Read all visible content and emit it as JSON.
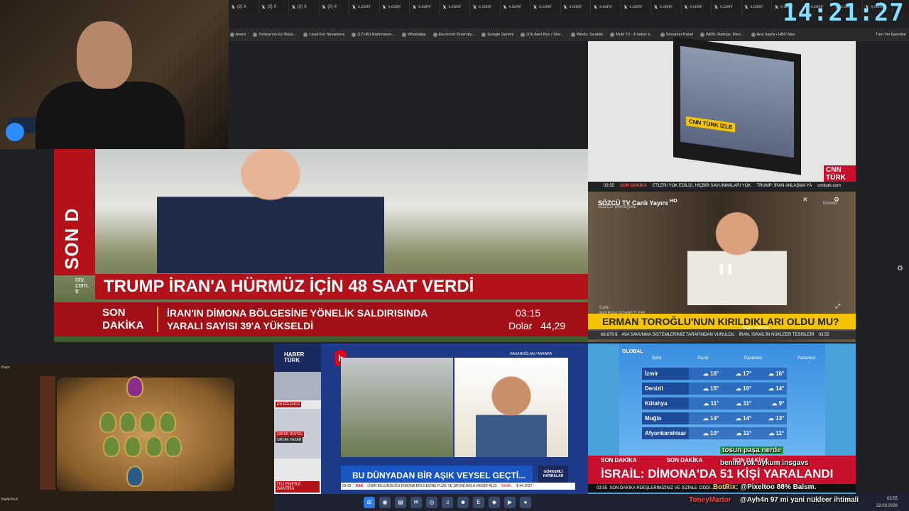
{
  "clock": "14:21:27",
  "browser": {
    "tabs": [
      {
        "label": "(2) X"
      },
      {
        "label": "(2) X"
      },
      {
        "label": "(2) X"
      },
      {
        "label": "(2) X"
      },
      {
        "label": "x.com/"
      },
      {
        "label": "x.com/"
      },
      {
        "label": "x.com/"
      },
      {
        "label": "x.com/"
      },
      {
        "label": "x.com/"
      },
      {
        "label": "x.com/"
      },
      {
        "label": "x.com/"
      },
      {
        "label": "x.com/"
      },
      {
        "label": "x.com/"
      },
      {
        "label": "x.com/"
      },
      {
        "label": "x.com/"
      },
      {
        "label": "x.com/"
      },
      {
        "label": "x.com/"
      },
      {
        "label": "x.com/"
      },
      {
        "label": "x.com/"
      },
      {
        "label": "x.com/"
      },
      {
        "label": "x.com/"
      },
      {
        "label": "x.com/"
      }
    ],
    "bookmarks": [
      "board",
      "Türkiye'nin En Büyü...",
      "Livad For Streamers",
      "(17145) Rammstein...",
      "WhatsApp",
      "Electronic Diversity...",
      "Google Gemini",
      "(19) Alert Box / Stre...",
      "Windy: Sıcaklık",
      "Multi TV - 6 haber k...",
      "Streamer Panel",
      "IMDb: Ratings, Revi...",
      "Ana Sayfa • HBO Max"
    ],
    "all_bookmarks": "Tüm Yer İşaretleri"
  },
  "ntv": {
    "side_label": "SON D",
    "logo": [
      "ntv.",
      "com.",
      "tr"
    ],
    "headline": "TRUMP İRAN'A HÜRMÜZ İÇİN 48 SAAT VERDİ",
    "ticker_label": [
      "SON",
      "DAKİKA"
    ],
    "ticker_text": [
      "İRAN'IN DİMONA BÖLGESİNE YÖNELİK SALDIRISINDA",
      "YARALI SAYISI 39'A YÜKSELDİ"
    ],
    "time": "03:15",
    "dolar_label": "Dolar",
    "dolar_value": "44,29"
  },
  "cnn": {
    "screen_text": "CNN TÜRK İZLE",
    "logo": "CNN TÜRK",
    "bar_time": "03:55",
    "bar_label": "SON DAKİKA",
    "bar_text": "ETLERİ YOK EDİLDİ, HİÇBİR SAVUNMALARI YOK",
    "bar_text2": "TRUMP: İRAN ANLAŞMA YA",
    "site": "cnnturk.com"
  },
  "sozcu": {
    "title": "SÖZCÜ TV Canlı Yayını",
    "hd": "HD",
    "subtitle": "SÖZCÜ Televizyonu",
    "canli": "Canlı",
    "program": "BAYRAM SOHBETLERİ",
    "headline": "ERMAN TOROĞLU'NUN KIRILDIKLARI OLDU MU?",
    "diger": "Diğer videolar",
    "strip_value": "68.679 $",
    "strip_text": "AVA SAVUNMA SİSTEMLERİMİZ TARAFINDAN VURULDU",
    "strip_text2": "İRAN, İSRAİL'İN NÜKLEER TESİSLERİ",
    "strip_time": "03:55",
    "tekrar": "TEKRAR"
  },
  "hearthstone": {
    "tiny_top": "Bupo",
    "tiny_bottom": "BattleTech"
  },
  "haberturk": {
    "logo": [
      "HABER",
      "TÜRK"
    ],
    "lbl1": "EN EĞLENCE",
    "lbl2": "ZAFER DUYGU",
    "lbl3": "ORTAK YAZAR",
    "enerji": "İTLİ ENERJİ SANTRA"
  },
  "halktv": {
    "logo": "h",
    "location": "HASANOĞLAN / ANKARA",
    "title": "BU DÜNYADAN BİR AŞIK VEYSEL GEÇTİ...",
    "gorkemli": [
      "GÖRKEMLİ",
      "HATIRALAR"
    ],
    "bottom_time": "03:23",
    "bottom_label": "DAK",
    "bottom_text": "LİNIN BULUNDUĞU DİMONA BÖLGESİNE FÜZE VE DRONLARLA HEDEF ALDI",
    "bottom_tag": "İSRAİL",
    "bottom_value": "$ 44.3027"
  },
  "global": {
    "logo": "GLOBAL",
    "headers": [
      "Şehir",
      "Pazar",
      "Pazartesi",
      "Pazartesi"
    ],
    "rows": [
      {
        "city": "İzmir",
        "v": [
          "16",
          "17",
          "16"
        ]
      },
      {
        "city": "Denizli",
        "v": [
          "15",
          "16",
          "14"
        ]
      },
      {
        "city": "Kütahya",
        "v": [
          "11",
          "11",
          "9"
        ]
      },
      {
        "city": "Muğla",
        "v": [
          "14",
          "14",
          "13"
        ]
      },
      {
        "city": "Afyonkarahisar",
        "v": [
          "10",
          "11",
          "11"
        ]
      }
    ],
    "degree": "°",
    "son_dakika": [
      "SON DAKİKA",
      "SON DAKİKA",
      "SON DAKİKA"
    ],
    "israil": "İSRAİL: DİMONA'DA 51 KİŞİ YARALANDI",
    "ticker_time": "03:55",
    "ticker_text": "SON DAKİKA RDEŞLERİMİZİNİZ VE SİZİNLE CİDDİ...",
    "ticker_value": "0:45.6"
  },
  "chat": [
    {
      "user": "tosun paşa nerde",
      "text": ""
    },
    {
      "user": "",
      "text": "benim yok uykum insgavs"
    },
    {
      "user": "BotRix",
      "text": "@Pixeltoo 88% Balsm."
    },
    {
      "user": "ToneyMartor",
      "text": "@Ayh4n 97 mi yani nükleer ihtimali"
    }
  ],
  "taskbar": {
    "time": "03:55",
    "date": "22.03.2026"
  }
}
